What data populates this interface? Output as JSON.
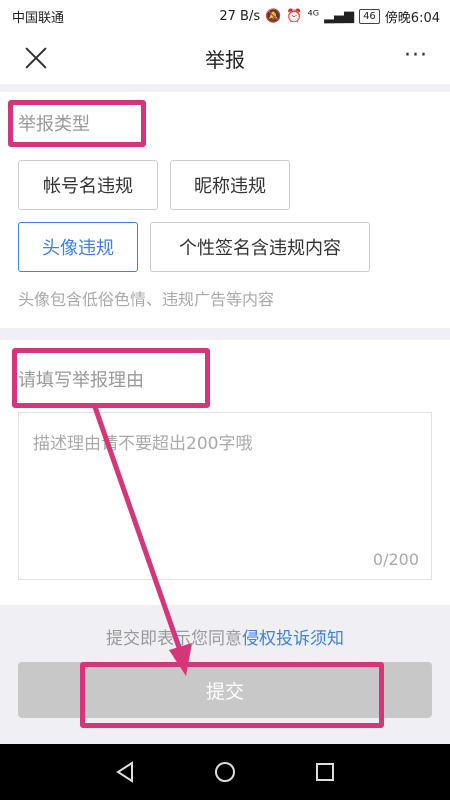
{
  "status_bar": {
    "carrier": "中国联通",
    "speed": "27 B/s",
    "network": "⁴ᴳ",
    "battery": "46",
    "time": "傍晚6:04"
  },
  "nav": {
    "title": "举报",
    "more": "···"
  },
  "report_type": {
    "title": "举报类型",
    "options": [
      "帐号名违规",
      "昵称违规",
      "头像违规",
      "个性签名含违规内容"
    ],
    "selected": "头像违规",
    "hint": "头像包含低俗色情、违规广告等内容"
  },
  "reason": {
    "title": "请填写举报理由",
    "placeholder": "描述理由请不要超出200字哦",
    "counter": "0/200"
  },
  "notice": {
    "prefix": "提交即表示您同意",
    "link": "侵权投诉须知"
  },
  "submit": {
    "label": "提交"
  },
  "colors": {
    "accent": "#3d82e0",
    "annotation": "#d6357a",
    "button_disabled": "#c8c8c8"
  }
}
